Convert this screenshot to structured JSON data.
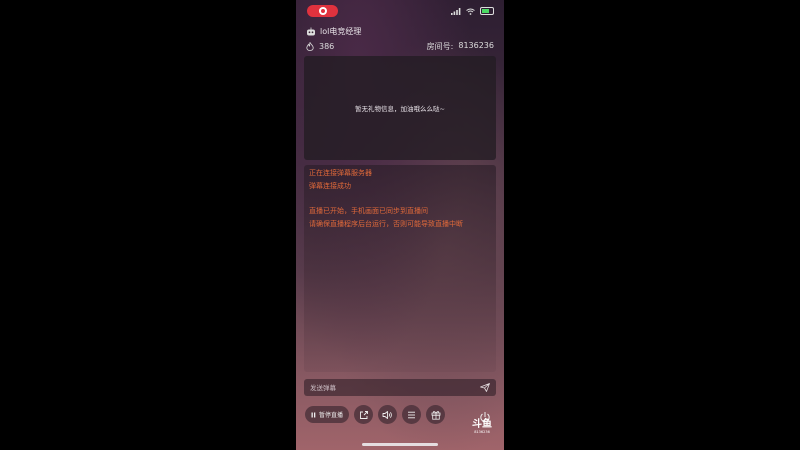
{
  "header": {
    "channel_name": "lol电竞经理"
  },
  "stats": {
    "viewer_count": "386",
    "room_label": "房间号:",
    "room_number": "8136236"
  },
  "gift_panel": {
    "empty_text": "暂无礼物信息，加油哦么么哒~"
  },
  "chat": {
    "messages": [
      "正在连接弹幕服务器",
      "弹幕连接成功",
      "直播已开始，手机画面已同步到直播间",
      "请确保直播程序后台运行，否则可能导致直播中断"
    ]
  },
  "input": {
    "placeholder": "发送弹幕"
  },
  "controls": {
    "pause_label": "暂停直播"
  },
  "logo": {
    "brand": "斗鱼",
    "room_number": "8136236"
  },
  "icons": {
    "record": "record-icon",
    "signal": "signal-icon",
    "wifi": "wifi-icon",
    "battery": "battery-icon",
    "robot": "robot-avatar-icon",
    "flame": "flame-icon",
    "send": "send-icon",
    "share": "share-icon",
    "speaker": "speaker-icon",
    "menu": "menu-icon",
    "gift": "gift-icon",
    "power": "power-icon"
  },
  "colors": {
    "record_red": "#e0323e",
    "chat_text": "#e0693a"
  }
}
